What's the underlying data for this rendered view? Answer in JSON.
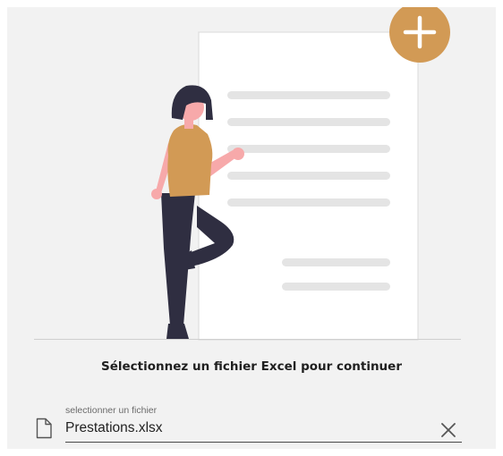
{
  "prompt": {
    "text": "Sélectionnez un fichier Excel pour continuer"
  },
  "file_input": {
    "label": "selectionner un fichier",
    "value": "Prestations.xlsx"
  },
  "icons": {
    "file": "file-icon",
    "clear": "close-icon",
    "add": "plus-icon"
  },
  "colors": {
    "accent": "#d29a55",
    "shirt": "#d29a55",
    "skin": "#f7a9aa",
    "dark": "#2f2e41",
    "document_line": "#e4e4e4",
    "background": "#f2f2f2"
  }
}
